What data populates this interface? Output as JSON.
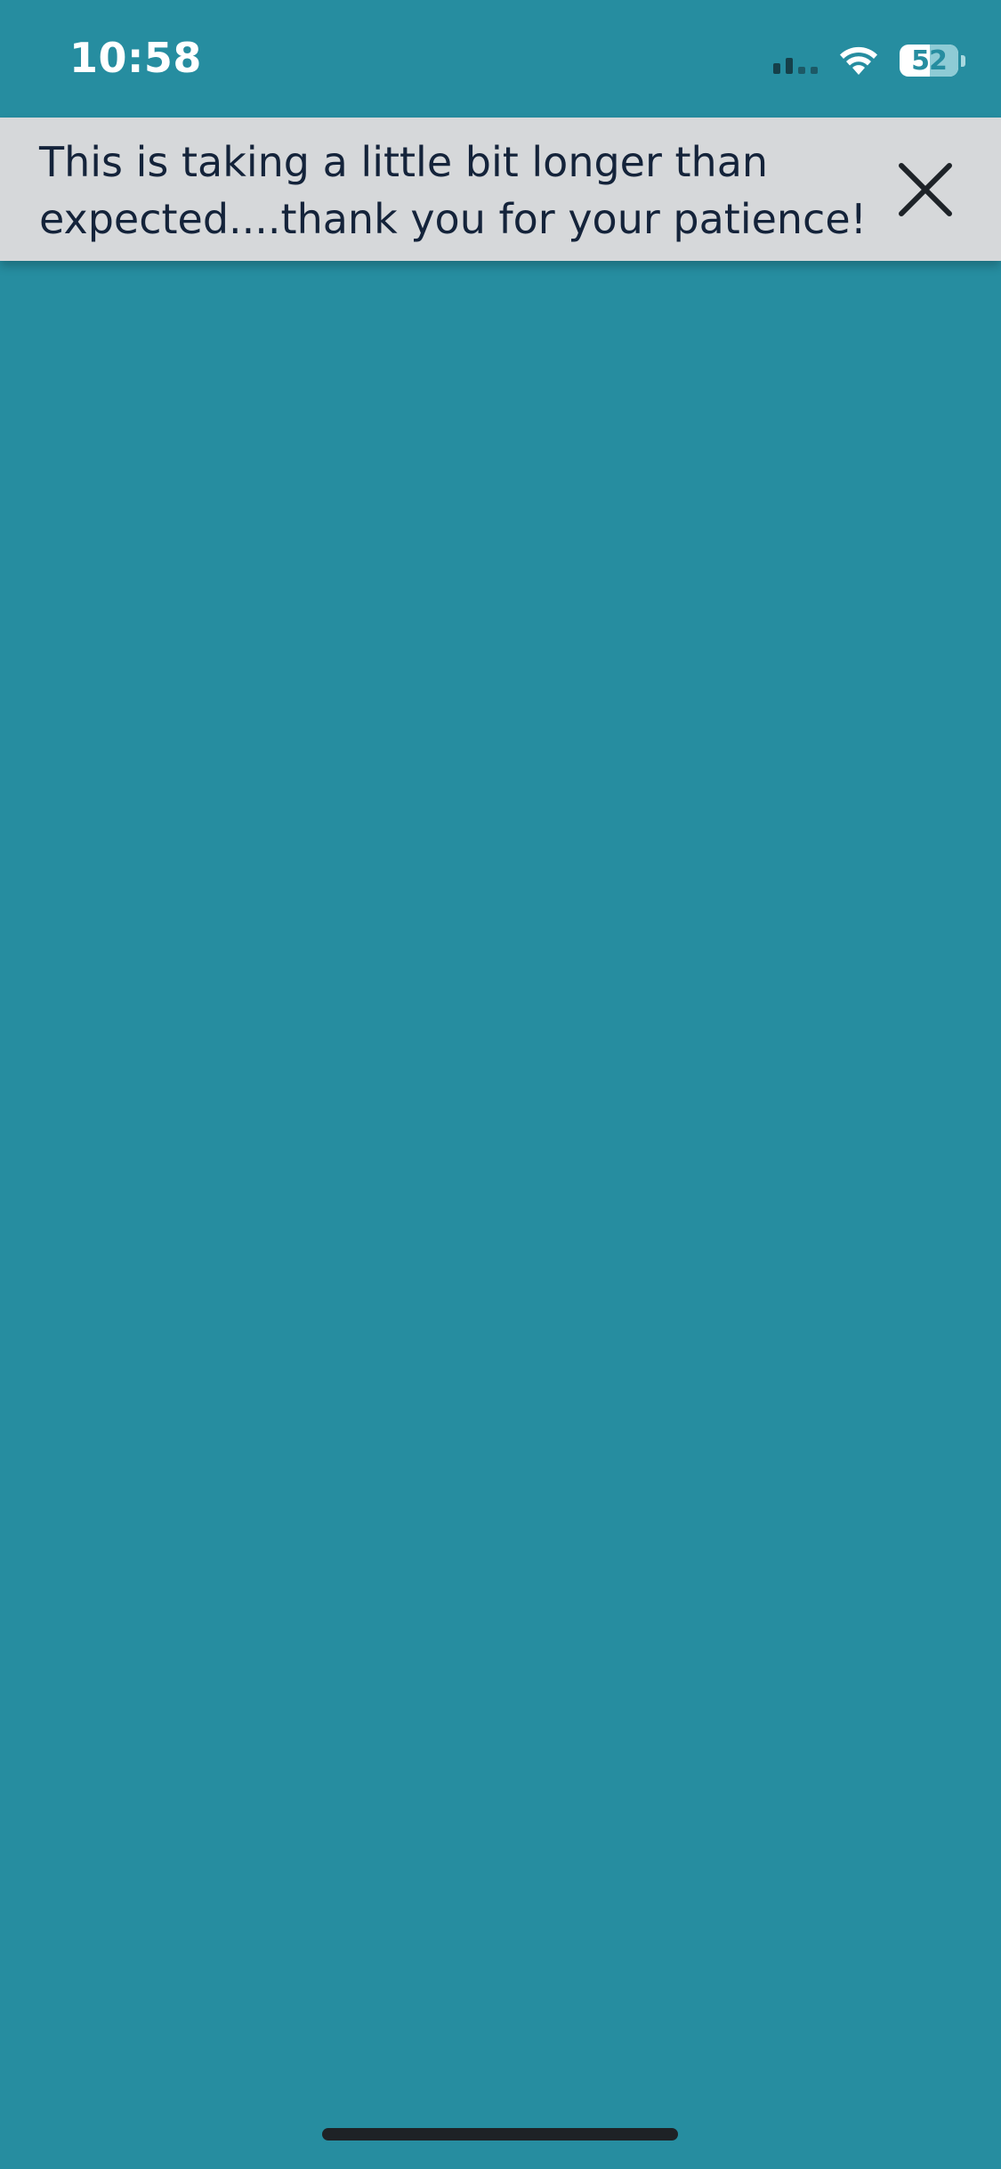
{
  "status_bar": {
    "time": "10:58",
    "battery_percent": "52",
    "battery_level": 0.52,
    "signal_bars_active": 2,
    "signal_bars_total": 4,
    "wifi_icon": "wifi-icon"
  },
  "banner": {
    "message": "This is taking a little bit longer than expected....thank you for your patience!",
    "close_icon": "close-icon",
    "background_color": "#d6d8da",
    "text_color": "#14233a"
  },
  "theme": {
    "background_color": "#268da0",
    "home_indicator_color": "#1e2226"
  }
}
